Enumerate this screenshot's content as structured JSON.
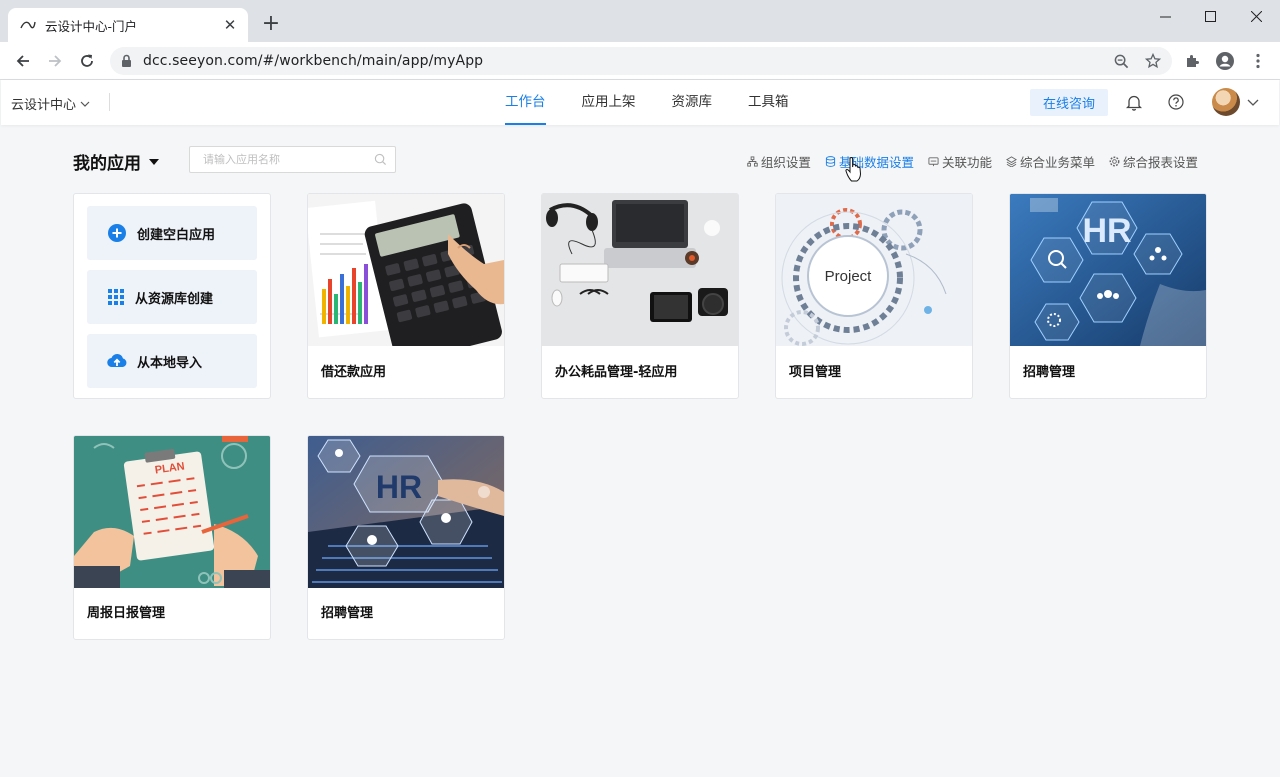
{
  "browser": {
    "tab_title": "云设计中心-门户",
    "url": "dcc.seeyon.com/#/workbench/main/app/myApp"
  },
  "header": {
    "brand": "云设计中心",
    "nav": [
      "工作台",
      "应用上架",
      "资源库",
      "工具箱"
    ],
    "active_nav": "工作台",
    "consult": "在线咨询"
  },
  "content": {
    "title": "我的应用",
    "search_placeholder": "请输入应用名称",
    "links": [
      {
        "label": "组织设置",
        "icon": "org-icon"
      },
      {
        "label": "基础数据设置",
        "icon": "database-icon"
      },
      {
        "label": "关联功能",
        "icon": "link-icon"
      },
      {
        "label": "综合业务菜单",
        "icon": "layers-icon"
      },
      {
        "label": "综合报表设置",
        "icon": "gear-icon"
      }
    ],
    "create_options": [
      {
        "label": "创建空白应用",
        "icon": "plus-circle-icon"
      },
      {
        "label": "从资源库创建",
        "icon": "grid-icon"
      },
      {
        "label": "从本地导入",
        "icon": "cloud-upload-icon"
      }
    ],
    "apps": [
      {
        "name": "借还款应用"
      },
      {
        "name": "办公耗品管理-轻应用"
      },
      {
        "name": "项目管理",
        "image_text": "Project"
      },
      {
        "name": "招聘管理",
        "image_text": "HR"
      },
      {
        "name": "周报日报管理",
        "image_text": "PLAN"
      },
      {
        "name": "招聘管理",
        "image_text": "HR"
      }
    ]
  },
  "colors": {
    "accent": "#1a7fe6",
    "background": "#f5f6f8"
  }
}
